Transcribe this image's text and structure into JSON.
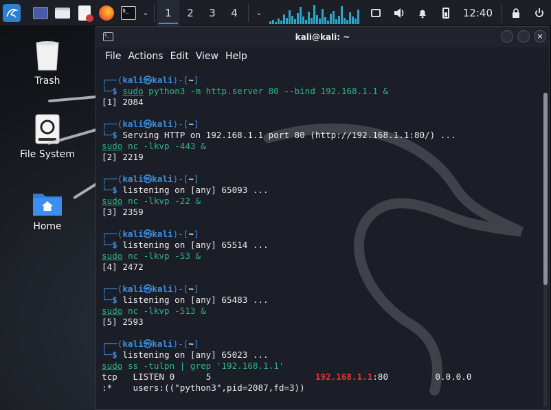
{
  "panel": {
    "workspaces": [
      "1",
      "2",
      "3",
      "4"
    ],
    "active_workspace": "1",
    "clock": "12:40",
    "icons": [
      "kali-menu-icon",
      "show-desktop-icon",
      "file-manager-icon",
      "text-editor-icon",
      "firefox-icon",
      "terminal-icon",
      "chevron-down-icon",
      "network-icon",
      "volume-icon",
      "notification-bell-icon",
      "battery-icon",
      "lock-icon",
      "power-icon"
    ]
  },
  "desktop": {
    "icons": [
      {
        "label": "Trash"
      },
      {
        "label": "File System"
      },
      {
        "label": "Home"
      }
    ]
  },
  "window": {
    "title": "kali@kali: ~",
    "menu": [
      "File",
      "Actions",
      "Edit",
      "View",
      "Help"
    ]
  },
  "terminal": {
    "user": "kali",
    "host": "kali",
    "dir": "~",
    "blocks": [
      {
        "cmd_sudo": "sudo",
        "cmd_rest": "python3 -m http.server 80 --bind 192.168.1.1 &",
        "job": "[1] 2084"
      },
      {
        "output": "Serving HTTP on 192.168.1.1 port 80 (http://192.168.1.1:80/) ...",
        "cmd_sudo": "sudo",
        "cmd_rest": "nc -lkvp -443 &",
        "job": "[2] 2219"
      },
      {
        "output": "listening on [any] 65093 ...",
        "cmd_sudo": "sudo",
        "cmd_rest": "nc -lkvp -22 &",
        "job": "[3] 2359"
      },
      {
        "output": "listening on [any] 65514 ...",
        "cmd_sudo": "sudo",
        "cmd_rest": "nc -lkvp -53 &",
        "job": "[4] 2472"
      },
      {
        "output": "listening on [any] 65483 ...",
        "cmd_sudo": "sudo",
        "cmd_rest": "nc -lkvp -513 &",
        "job": "[5] 2593"
      },
      {
        "output": "listening on [any] 65023 ...",
        "cmd_sudo": "sudo",
        "cmd_rest": "ss -tulpn | grep '192.168.1.1'"
      }
    ],
    "ss_row": {
      "proto": "tcp",
      "state": "LISTEN",
      "recvq": "0",
      "sendq": "5",
      "local_ip": "192.168.1.1",
      "local_port": ":80",
      "peer": "0.0.0.0",
      "peer_port": ":*",
      "process": "users:((\"python3\",pid=2087,fd=3))"
    }
  },
  "colors": {
    "accent": "#3b8fe0",
    "prompt_green": "#2fb387",
    "highlight_red": "#e53636",
    "string_yellow": "#e5c07b"
  }
}
